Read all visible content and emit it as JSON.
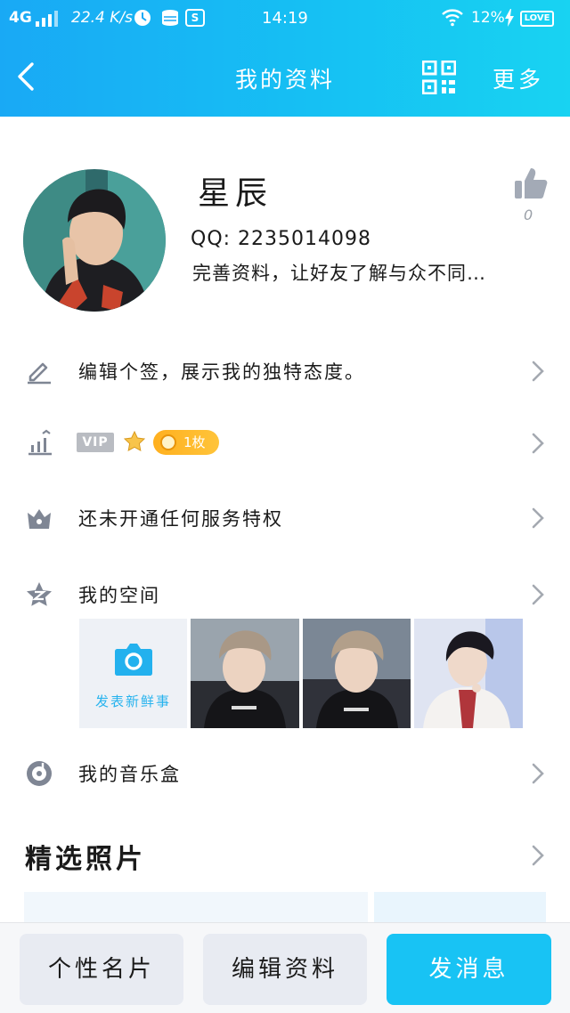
{
  "status_bar": {
    "network": "4G",
    "speed": "22.4 K/s",
    "app_badge": "S",
    "time": "14:19",
    "battery_percent": "12%",
    "battery_label": "LOVE"
  },
  "nav": {
    "title": "我的资料",
    "more_label": "更多"
  },
  "profile": {
    "name": "星辰",
    "qq": "QQ: 2235014098",
    "bio": "完善资料，让好友了解与众不同…",
    "like_count": "0"
  },
  "rows": {
    "signature": "编辑个签，展示我的独特态度。",
    "vip_badge": "VIP",
    "coin_label": "1枚",
    "privilege": "还未开通任何服务特权",
    "zone": "我的空间",
    "music": "我的音乐盒"
  },
  "zone": {
    "post_label": "发表新鲜事"
  },
  "featured": {
    "title": "精选照片"
  },
  "bottom": {
    "card": "个性名片",
    "edit": "编辑资料",
    "message": "发消息"
  },
  "colors": {
    "header_start": "#19a9f5",
    "header_end": "#18d3f2",
    "accent": "#18c3f4",
    "coin": "#ffb01f"
  },
  "icons": [
    "back-arrow-icon",
    "qr-code-icon",
    "thumbs-up-icon",
    "pencil-icon",
    "chart-icon",
    "crown-icon",
    "zone-star-icon",
    "music-disc-icon",
    "camera-icon",
    "chevron-right-icon"
  ]
}
